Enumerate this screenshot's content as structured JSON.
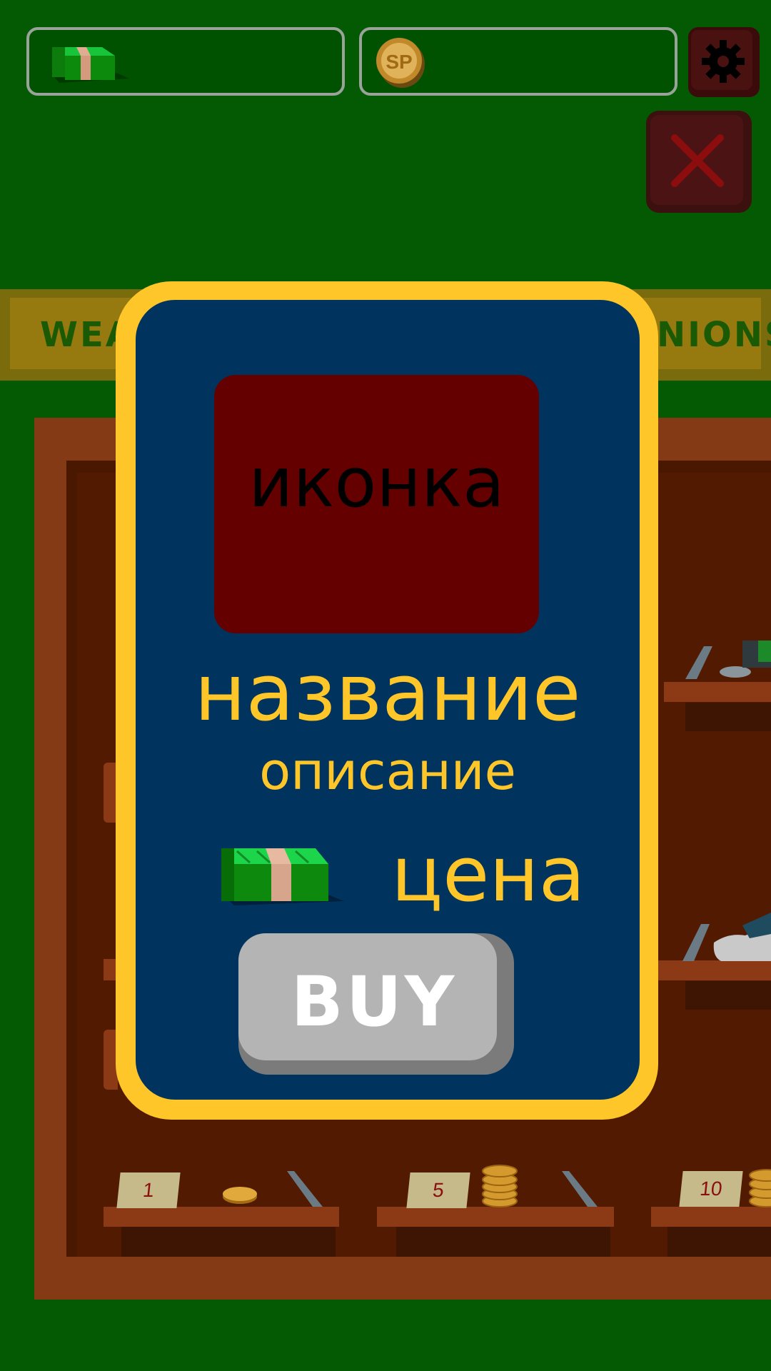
{
  "top_bar": {
    "cash_value": "",
    "sp_value": "",
    "coin_label": "SP"
  },
  "tabs": {
    "left_label": "WEA",
    "right_label": "NIONS"
  },
  "popup": {
    "icon_text": "иконка",
    "name": "название",
    "description": "описание",
    "price": "цена",
    "buy_label": "BUY"
  },
  "shelves": {
    "tags": [
      "1",
      "5",
      "10"
    ]
  },
  "colors": {
    "background": "#035a03",
    "popup_border": "#ffc629",
    "popup_panel": "#00345e",
    "accent_text": "#ffc629"
  },
  "icons": [
    "cash-stack-icon",
    "sp-coin-icon",
    "gear-icon",
    "close-icon"
  ]
}
